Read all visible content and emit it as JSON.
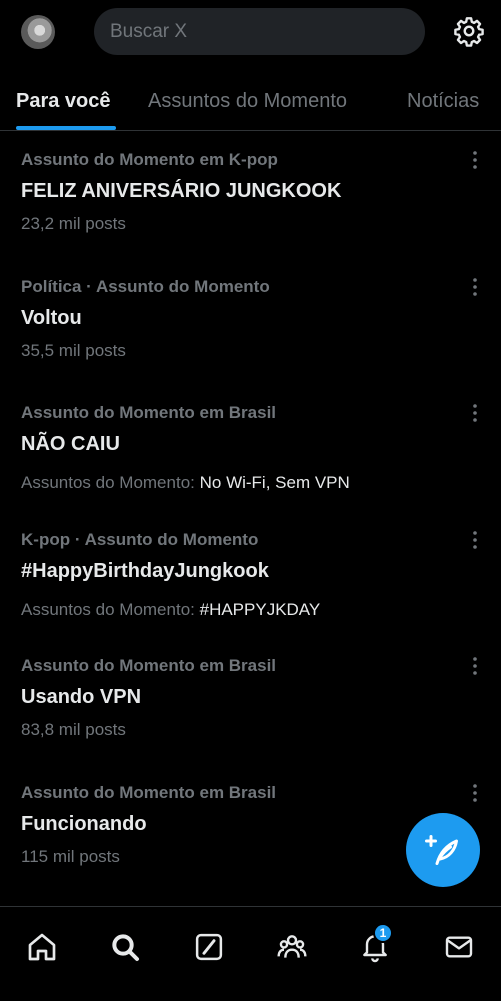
{
  "search": {
    "placeholder": "Buscar X"
  },
  "tabs": [
    {
      "label": "Para você",
      "active": true
    },
    {
      "label": "Assuntos do Momento",
      "active": false
    },
    {
      "label": "Notícias",
      "active": false
    }
  ],
  "trends": [
    {
      "meta": "Assunto do Momento em K-pop",
      "title": "FELIZ ANIVERSÁRIO JUNGKOOK",
      "count": "23,2 mil posts"
    },
    {
      "meta": "Política · Assunto do Momento",
      "title": "Voltou",
      "count": "35,5 mil posts"
    },
    {
      "meta": "Assunto do Momento em Brasil",
      "title": "NÃO CAIU",
      "related_prefix": "Assuntos do Momento:",
      "related": "No Wi-Fi, Sem VPN"
    },
    {
      "meta": "K-pop · Assunto do Momento",
      "title": "#HappyBirthdayJungkook",
      "related_prefix": "Assuntos do Momento:",
      "related": "#HAPPYJKDAY"
    },
    {
      "meta": "Assunto do Momento em Brasil",
      "title": "Usando VPN",
      "count": "83,8 mil posts"
    },
    {
      "meta": "Assunto do Momento em Brasil",
      "title": "Funcionando",
      "count": "115 mil posts"
    }
  ],
  "bottom_nav": [
    {
      "icon": "home-icon"
    },
    {
      "icon": "search-icon",
      "active": true
    },
    {
      "icon": "grok-icon"
    },
    {
      "icon": "communities-icon"
    },
    {
      "icon": "notifications-icon",
      "badge": "1"
    },
    {
      "icon": "messages-icon"
    }
  ],
  "fab": {
    "icon": "compose-post-icon"
  },
  "colors": {
    "accent": "#1d9bf0",
    "background": "#000000",
    "muted": "#71767b",
    "text": "#e7e9ea"
  }
}
